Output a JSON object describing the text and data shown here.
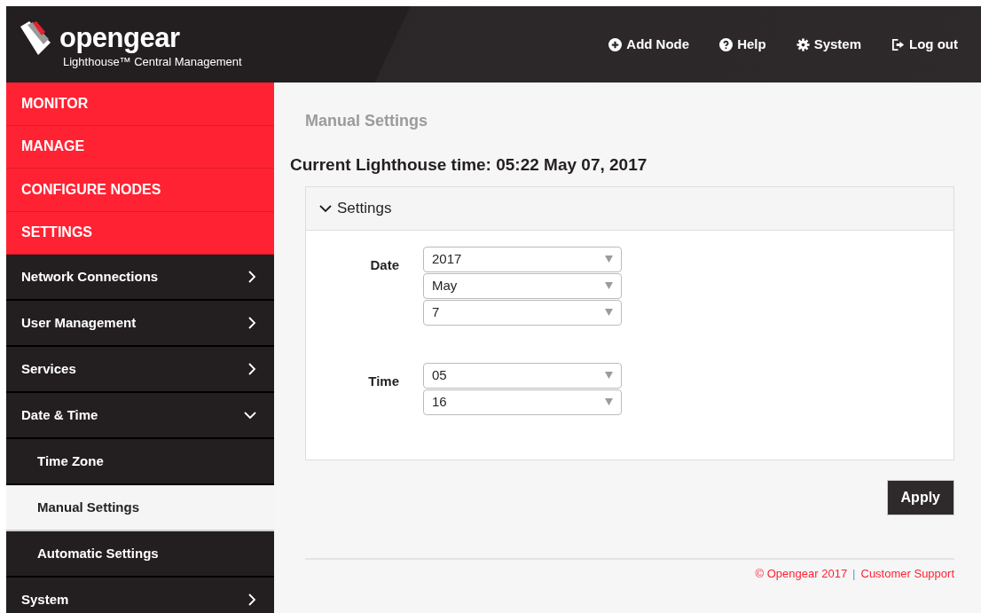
{
  "header": {
    "logo": "opengear",
    "subtitle": "Lighthouse™ Central Management",
    "nav": [
      {
        "kind": "add",
        "label": "Add Node"
      },
      {
        "kind": "help",
        "label": "Help"
      },
      {
        "kind": "gear",
        "label": "System"
      },
      {
        "kind": "logout",
        "label": "Log out"
      }
    ]
  },
  "sidebar": {
    "items": [
      {
        "kind": "category",
        "label": "MONITOR"
      },
      {
        "kind": "category",
        "label": "MANAGE"
      },
      {
        "kind": "category",
        "label": "CONFIGURE NODES"
      },
      {
        "kind": "category",
        "label": "SETTINGS"
      },
      {
        "kind": "section",
        "label": "Network Connections",
        "expanded": false
      },
      {
        "kind": "section",
        "label": "User Management",
        "expanded": false
      },
      {
        "kind": "section",
        "label": "Services",
        "expanded": false
      },
      {
        "kind": "section",
        "label": "Date & Time",
        "expanded": true,
        "children": [
          {
            "label": "Time Zone",
            "selected": false
          },
          {
            "label": "Manual Settings",
            "selected": true
          },
          {
            "label": "Automatic Settings",
            "selected": false
          }
        ]
      },
      {
        "kind": "section",
        "label": "System",
        "expanded": false
      }
    ]
  },
  "page_title": "Manual Settings",
  "current_time": "Current Lighthouse time: 05:22 May 07, 2017",
  "panel": {
    "title": "Settings",
    "expanded": true,
    "fields": [
      {
        "label": "Date",
        "selects": [
          "2017",
          "May",
          "7"
        ]
      },
      {
        "label": "Time",
        "selects": [
          "05",
          "16"
        ]
      }
    ]
  },
  "apply_button": "Apply",
  "footer": {
    "copyright": "© Opengear 2017",
    "separator": "|",
    "link": "Customer Support"
  }
}
